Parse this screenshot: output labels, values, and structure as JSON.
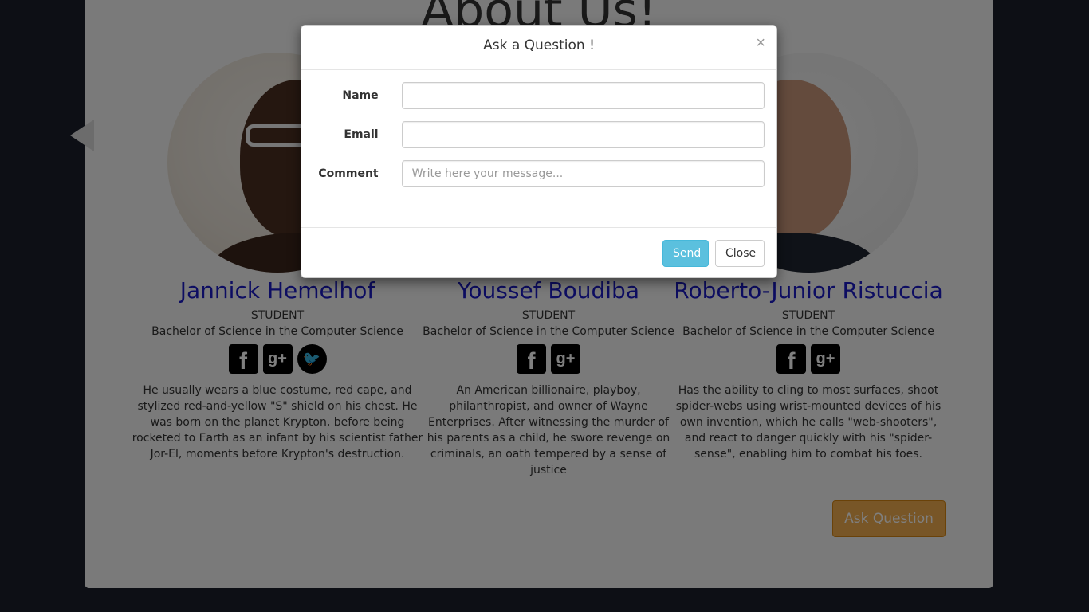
{
  "page": {
    "section_title": "About Us!",
    "ask_button_label": "Ask Question"
  },
  "members": [
    {
      "name": "Jannick Hemelhof",
      "role": "STUDENT",
      "degree": "Bachelor of Science in the Computer Science",
      "socials": [
        "facebook-icon",
        "google-plus-icon",
        "twitter-icon"
      ],
      "bio": "He usually wears a blue costume, red cape, and stylized red-and-yellow \"S\" shield on his chest. He was born on the planet Krypton, before being rocketed to Earth as an infant by his scientist father Jor-El, moments before Krypton's destruction."
    },
    {
      "name": "Youssef Boudiba",
      "role": "STUDENT",
      "degree": "Bachelor of Science in the Computer Science",
      "socials": [
        "facebook-icon",
        "google-plus-icon"
      ],
      "bio": "An American billionaire, playboy, philanthropist, and owner of Wayne Enterprises. After witnessing the murder of his parents as a child, he swore revenge on criminals, an oath tempered by a sense of justice"
    },
    {
      "name": "Roberto-Junior Ristuccia",
      "role": "STUDENT",
      "degree": "Bachelor of Science in the Computer Science",
      "socials": [
        "facebook-icon",
        "google-plus-icon"
      ],
      "bio": "Has the ability to cling to most surfaces, shoot spider-webs using wrist-mounted devices of his own invention, which he calls \"web-shooters\", and react to danger quickly with his \"spider-sense\", enabling him to combat his foes."
    }
  ],
  "social_glyphs": {
    "facebook": "f",
    "google_plus": "g+",
    "twitter": "🐦"
  },
  "modal": {
    "title": "Ask a Question !",
    "close_x": "×",
    "fields": {
      "name_label": "Name",
      "name_value": "",
      "email_label": "Email",
      "email_value": "",
      "comment_label": "Comment",
      "comment_placeholder": "Write here your message..."
    },
    "send_label": "Send",
    "close_label": "Close"
  },
  "colors": {
    "name_link": "#1a1ac4",
    "ask_button": "#f0ad4e",
    "send_button": "#5bc0de"
  }
}
